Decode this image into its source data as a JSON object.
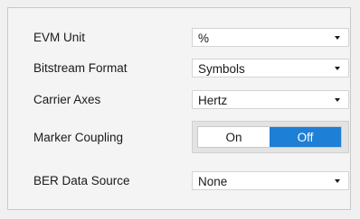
{
  "settings": [
    {
      "label": "EVM Unit",
      "value": "%"
    },
    {
      "label": "Bitstream Format",
      "value": "Symbols"
    },
    {
      "label": "Carrier Axes",
      "value": "Hertz"
    },
    {
      "label": "Marker Coupling",
      "toggle": {
        "options": [
          "On",
          "Off"
        ],
        "selected": "Off"
      }
    },
    {
      "label": "BER Data Source",
      "value": "None"
    }
  ],
  "colors": {
    "toggle_selected": "#1e7fd6",
    "background": "#f0f0f0"
  }
}
